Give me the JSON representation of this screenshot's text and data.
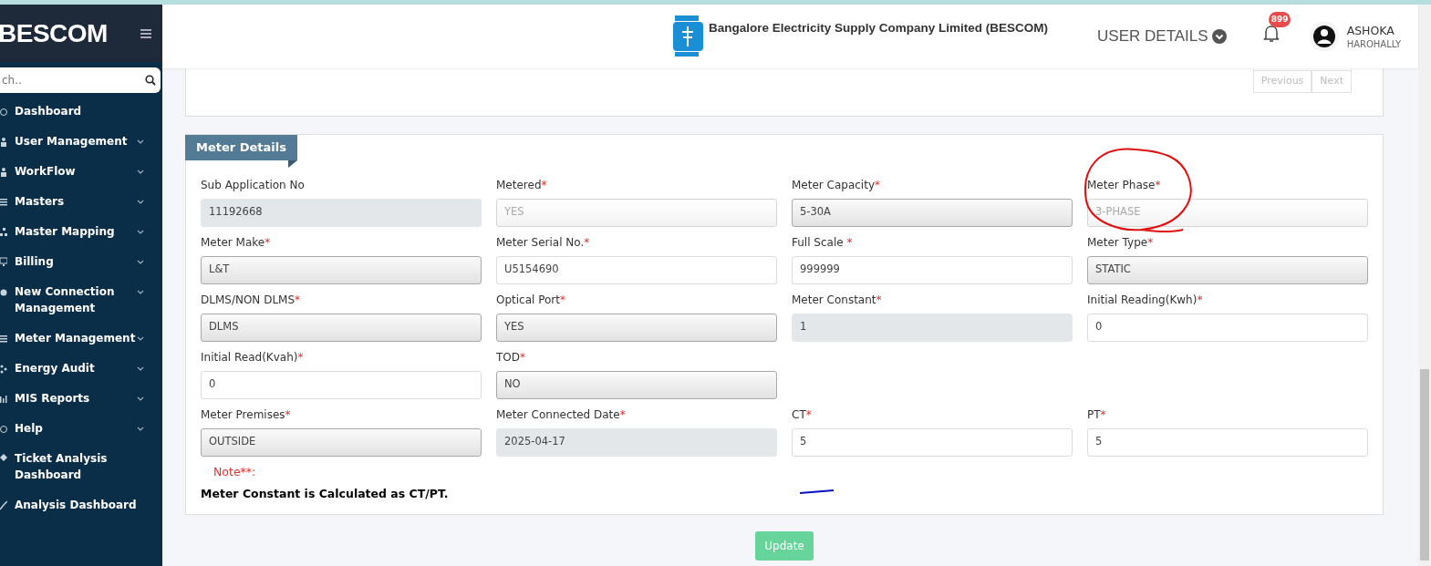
{
  "sidebar": {
    "brand": "BESCOM",
    "search": {
      "placeholder": "ch.."
    },
    "items": [
      {
        "label": "Dashboard",
        "expandable": false
      },
      {
        "label": "User Management",
        "expandable": true
      },
      {
        "label": "WorkFlow",
        "expandable": true
      },
      {
        "label": "Masters",
        "expandable": true
      },
      {
        "label": "Master Mapping",
        "expandable": true
      },
      {
        "label": "Billing",
        "expandable": true
      },
      {
        "label": "New Connection Management",
        "expandable": true
      },
      {
        "label": "Meter Management",
        "expandable": true
      },
      {
        "label": "Energy Audit",
        "expandable": true
      },
      {
        "label": "MIS Reports",
        "expandable": true
      },
      {
        "label": "Help",
        "expandable": true
      },
      {
        "label": "Ticket Analysis Dashboard",
        "expandable": false
      },
      {
        "label": "Analysis Dashboard",
        "expandable": false
      }
    ]
  },
  "header": {
    "company": "Bangalore Electricity Supply Company Limited (BESCOM)",
    "user_details": "USER DETAILS",
    "notifications": "899",
    "user": {
      "name": "ASHOKA",
      "location": "HAROHALLY"
    }
  },
  "pager": {
    "buttons": [
      {
        "label": "Previous",
        "disabled": true
      },
      {
        "label": "Next",
        "disabled": true
      }
    ]
  },
  "meter_details": {
    "title": "Meter Details",
    "rows": [
      [
        {
          "label": "Sub Application No",
          "value": "11192668",
          "kind": "readonly"
        },
        {
          "label": "Metered",
          "mark": "*",
          "value": "YES",
          "kind": "disabled"
        },
        {
          "label": "Meter Capacity",
          "mark": "*",
          "value": "5-30A",
          "kind": "select"
        },
        {
          "label": "Meter Phase",
          "mark": "*",
          "value": "3-PHASE",
          "kind": "disabled"
        }
      ],
      [
        {
          "label": "Meter Make",
          "mark": "*",
          "value": "L&T",
          "kind": "select"
        },
        {
          "label": "Meter Serial No.",
          "mark": "*",
          "value": "U5154690",
          "kind": "input"
        },
        {
          "label": "Full Scale ",
          "mark": "*",
          "value": "999999",
          "kind": "input"
        },
        {
          "label": "Meter Type",
          "mark": "*",
          "value": "STATIC",
          "kind": "select"
        }
      ],
      [
        {
          "label": "DLMS/NON DLMS",
          "mark": "*",
          "value": "DLMS",
          "kind": "select"
        },
        {
          "label": "Optical Port",
          "mark": "*",
          "value": "YES",
          "kind": "select"
        },
        {
          "label": "Meter Constant",
          "mark": "*",
          "value": "1",
          "kind": "readonly"
        },
        {
          "label": "Initial Reading(Kwh)",
          "mark": "*",
          "value": "0",
          "kind": "input"
        }
      ],
      [
        {
          "label": "Initial Read(Kvah)",
          "mark": "*",
          "value": "0",
          "kind": "input"
        },
        {
          "label": "TOD",
          "mark": "*",
          "value": "NO",
          "kind": "select"
        }
      ],
      [
        {
          "label": "Meter Premises",
          "mark": "*",
          "value": "OUTSIDE",
          "kind": "select"
        },
        {
          "label": "Meter Connected Date",
          "mark": "*",
          "value": "2025-04-17",
          "kind": "readonly"
        },
        {
          "label": "CT",
          "mark": "*",
          "value": "5",
          "kind": "input"
        },
        {
          "label": "PT",
          "mark": "*",
          "value": "5",
          "kind": "input"
        }
      ]
    ],
    "note_label": "Note**:",
    "note": "Meter Constant is Calculated as CT/PT."
  },
  "update_button": {
    "label": "Update",
    "disabled": true
  }
}
